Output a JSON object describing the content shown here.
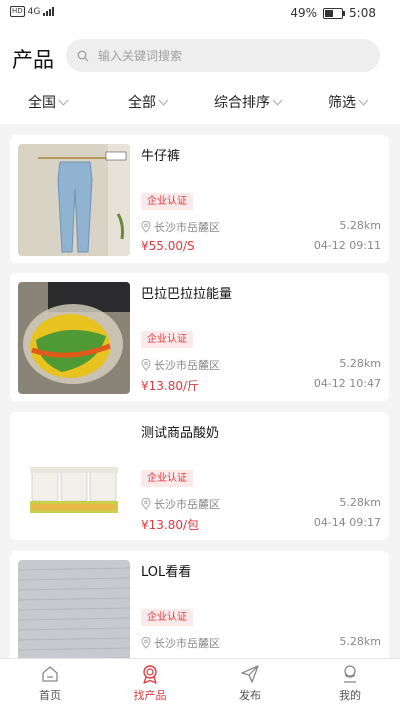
{
  "status_bar": {
    "signal": "4G",
    "battery": "49%",
    "time": "5:08"
  },
  "header": {
    "title": "产品",
    "search_placeholder": "输入关键词搜索"
  },
  "filters": [
    {
      "label": "全国"
    },
    {
      "label": "全部"
    },
    {
      "label": "综合排序"
    },
    {
      "label": "筛选"
    }
  ],
  "products": [
    {
      "name": "牛仔裤",
      "badge": "企业认证",
      "location": "长沙市岳麓区",
      "distance": "5.28km",
      "price": "¥55.00/S",
      "time": "04-12 09:11",
      "image": "jeans"
    },
    {
      "name": "巴拉巴拉拉能量",
      "badge": "企业认证",
      "location": "长沙市岳麓区",
      "distance": "5.28km",
      "price": "¥13.80/斤",
      "time": "04-12 10:47",
      "image": "ball"
    },
    {
      "name": "测试商品酸奶",
      "badge": "企业认证",
      "location": "长沙市岳麓区",
      "distance": "5.28km",
      "price": "¥13.80/包",
      "time": "04-14 09:17",
      "image": "yogurt"
    },
    {
      "name": "LOL看看",
      "badge": "企业认证",
      "location": "长沙市岳麓区",
      "distance": "5.28km",
      "image": "paper"
    }
  ],
  "tabs": [
    {
      "label": "首页",
      "icon": "home-icon"
    },
    {
      "label": "找产品",
      "icon": "product-icon",
      "active": true
    },
    {
      "label": "发布",
      "icon": "send-icon"
    },
    {
      "label": "我的",
      "icon": "user-icon"
    }
  ],
  "colors": {
    "accent": "#e0383e",
    "badge_bg": "#fce9e9"
  }
}
